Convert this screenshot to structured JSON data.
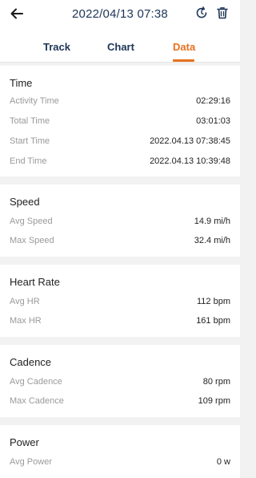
{
  "header": {
    "title": "2022/04/13 07:38",
    "back_icon": "arrow-left-icon",
    "refresh_icon": "refresh-icon",
    "delete_icon": "trash-icon"
  },
  "tabs": [
    {
      "label": "Track",
      "active": false
    },
    {
      "label": "Chart",
      "active": false
    },
    {
      "label": "Data",
      "active": true
    }
  ],
  "colors": {
    "accent": "#e8711f",
    "navy": "#1d3557"
  },
  "sections": {
    "time": {
      "title": "Time",
      "rows": [
        {
          "label": "Activity Time",
          "value": "02:29:16"
        },
        {
          "label": "Total Time",
          "value": "03:01:03"
        },
        {
          "label": "Start Time",
          "value": "2022.04.13 07:38:45"
        },
        {
          "label": "End Time",
          "value": "2022.04.13 10:39:48"
        }
      ]
    },
    "speed": {
      "title": "Speed",
      "rows": [
        {
          "label": "Avg Speed",
          "value": "14.9 mi/h"
        },
        {
          "label": "Max Speed",
          "value": "32.4 mi/h"
        }
      ]
    },
    "heart_rate": {
      "title": "Heart Rate",
      "rows": [
        {
          "label": "Avg HR",
          "value": "112 bpm"
        },
        {
          "label": "Max HR",
          "value": "161 bpm"
        }
      ]
    },
    "cadence": {
      "title": "Cadence",
      "rows": [
        {
          "label": "Avg Cadence",
          "value": "80 rpm"
        },
        {
          "label": "Max Cadence",
          "value": "109 rpm"
        }
      ]
    },
    "power": {
      "title": "Power",
      "rows": [
        {
          "label": "Avg Power",
          "value": "0 w"
        }
      ]
    }
  }
}
